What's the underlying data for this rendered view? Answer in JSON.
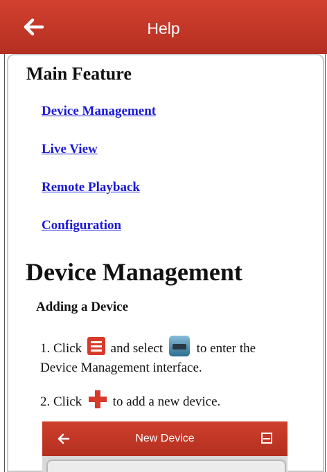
{
  "header": {
    "title": "Help",
    "back_icon": "arrow-left-icon"
  },
  "main_heading": "Main Feature",
  "toc": [
    {
      "label": "Device Management"
    },
    {
      "label": "Live View"
    },
    {
      "label": "Remote Playback"
    },
    {
      "label": "Configuration"
    }
  ],
  "section": {
    "title": "Device Management",
    "subtitle": "Adding a Device",
    "step1": {
      "a": "1. Click",
      "b": "and select",
      "c": "to enter the"
    },
    "step1_line2": "Device Management interface.",
    "step2": {
      "a": "2. Click",
      "b": "to add a new device."
    }
  },
  "screenshot": {
    "title": "New Device",
    "back_icon": "arrow-left-icon",
    "save_icon": "save-icon"
  },
  "colors": {
    "header": "#c4392a",
    "link": "#1b19d4",
    "icon_red": "#d73a2a"
  }
}
